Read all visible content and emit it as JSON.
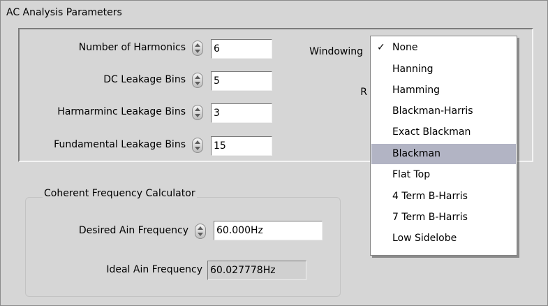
{
  "section_title": "AC Analysis Parameters",
  "params": {
    "harmonics": {
      "label": "Number of Harmonics",
      "value": "6"
    },
    "dc_leak": {
      "label": "DC Leakage Bins",
      "value": "5"
    },
    "harm_leak": {
      "label": "Harmarminc Leakage Bins",
      "value": "3"
    },
    "fund_leak": {
      "label": "Fundamental Leakage Bins",
      "value": "15"
    }
  },
  "windowing": {
    "label": "Windowing",
    "hidden_label_fragment": "R"
  },
  "window_menu": {
    "checked": "None",
    "highlighted": "Blackman",
    "items": [
      "None",
      "Hanning",
      "Hamming",
      "Blackman-Harris",
      "Exact Blackman",
      "Blackman",
      "Flat Top",
      "4 Term B-Harris",
      "7 Term B-Harris",
      "Low Sidelobe"
    ]
  },
  "calculator": {
    "title": "Coherent Frequency Calculator",
    "desired": {
      "label": "Desired Ain Frequency",
      "value": "60.000Hz"
    },
    "ideal": {
      "label": "Ideal Ain Frequency",
      "value": "60.027778Hz"
    }
  },
  "icons": {
    "spin": "numeric-spinner-icon",
    "check": "checkmark-icon"
  }
}
